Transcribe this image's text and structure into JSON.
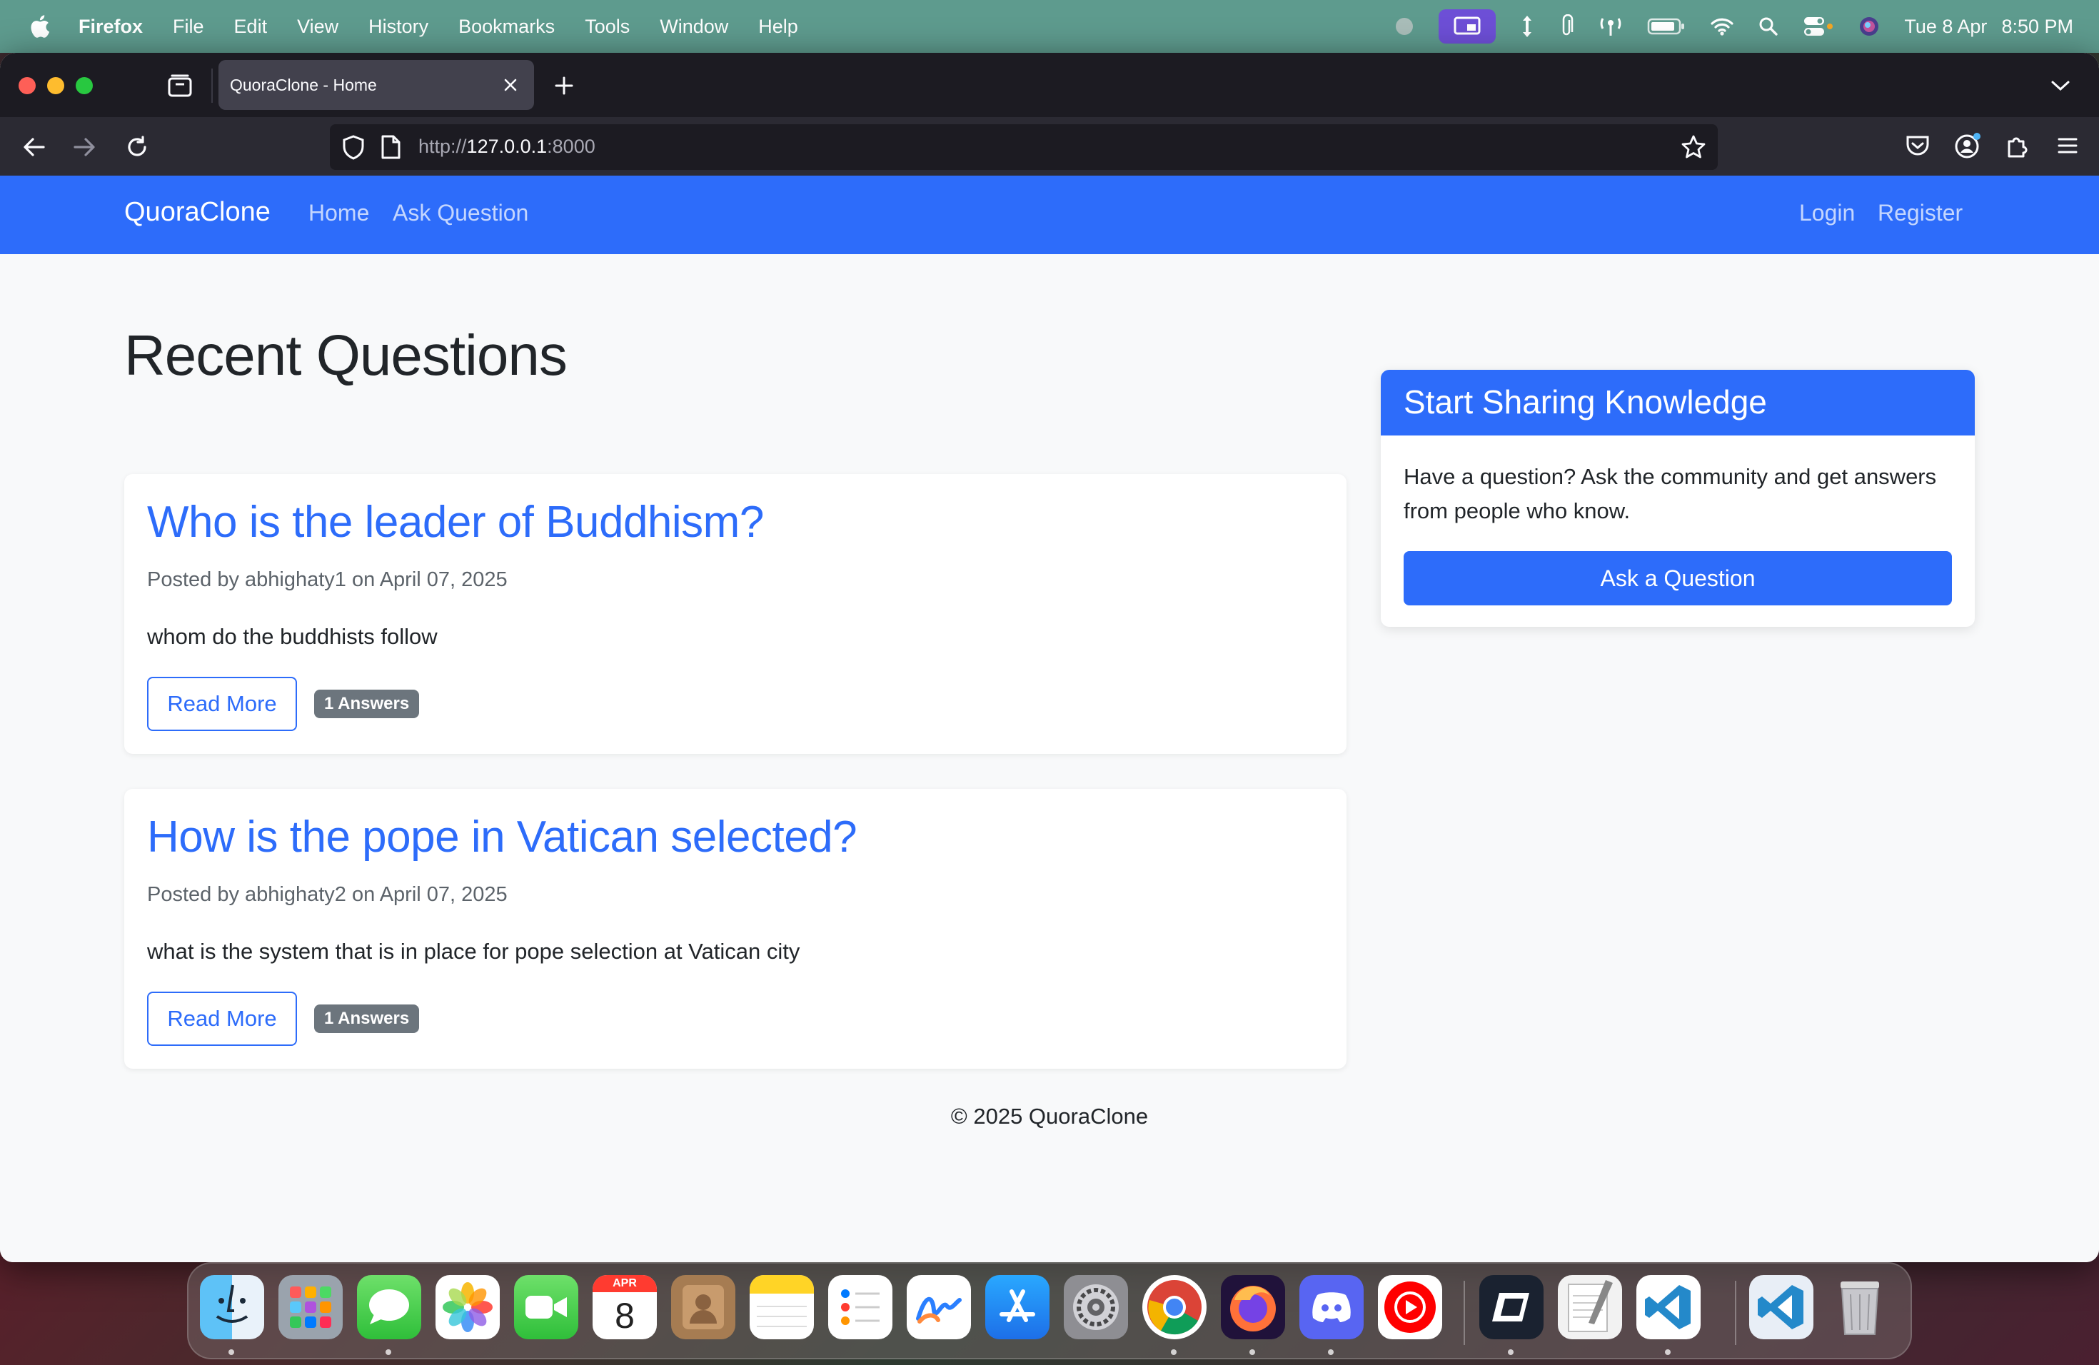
{
  "menubar": {
    "app_name": "Firefox",
    "menus": [
      "File",
      "Edit",
      "View",
      "History",
      "Bookmarks",
      "Tools",
      "Window",
      "Help"
    ],
    "clock": {
      "date": "Tue 8 Apr",
      "time": "8:50 PM"
    },
    "accent_color": "#6d4fd6"
  },
  "browser": {
    "tab": {
      "title": "QuoraClone - Home"
    },
    "url": {
      "scheme": "http://",
      "host": "127.0.0.1",
      "port": ":8000"
    }
  },
  "site": {
    "brand": "QuoraClone",
    "nav_left": [
      "Home",
      "Ask Question"
    ],
    "nav_right": [
      "Login",
      "Register"
    ],
    "primary_color": "#2d6cfa",
    "heading": "Recent Questions",
    "questions": [
      {
        "title": "Who is the leader of Buddhism?",
        "meta": "Posted by abhighaty1 on April 07, 2025",
        "body": "whom do the buddhists follow",
        "read_more": "Read More",
        "answers_badge": "1 Answers"
      },
      {
        "title": "How is the pope in Vatican selected?",
        "meta": "Posted by abhighaty2 on April 07, 2025",
        "body": "what is the system that is in place for pope selection at Vatican city",
        "read_more": "Read More",
        "answers_badge": "1 Answers"
      }
    ],
    "sidebar": {
      "title": "Start Sharing Knowledge",
      "text": "Have a question? Ask the community and get answers from people who know.",
      "button": "Ask a Question"
    },
    "footer": "© 2025 QuoraClone"
  },
  "dock": {
    "calendar_month": "APR",
    "calendar_day": "8",
    "apps": [
      "finder-icon",
      "launchpad-icon",
      "messages-icon",
      "photos-icon",
      "facetime-icon",
      "calendar-icon",
      "contacts-icon",
      "notes-icon",
      "reminders-icon",
      "freeform-icon",
      "app-store-icon",
      "system-settings-icon",
      "chrome-icon",
      "firefox-icon",
      "discord-icon",
      "youtube-music-icon",
      "remote-desktop-icon",
      "textedit-icon",
      "vscode-icon",
      "vscode-folder-icon",
      "trash-icon"
    ]
  }
}
